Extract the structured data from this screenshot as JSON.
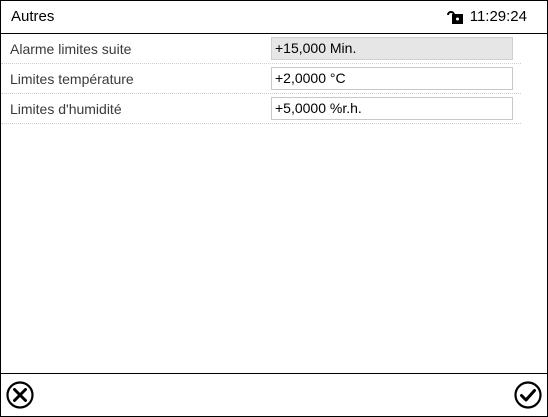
{
  "header": {
    "title": "Autres",
    "time": "11:29:24",
    "lock_icon": "unlocked-padlock-icon"
  },
  "settings": [
    {
      "label": "Alarme limites suite",
      "value": "+15,000 Min.",
      "editable": false
    },
    {
      "label": "Limites température",
      "value": "+2,0000 °C",
      "editable": true
    },
    {
      "label": "Limites d'humidité",
      "value": "+5,0000 %r.h.",
      "editable": true
    }
  ],
  "footer": {
    "cancel_icon": "cancel-icon",
    "confirm_icon": "checkmark-icon"
  }
}
